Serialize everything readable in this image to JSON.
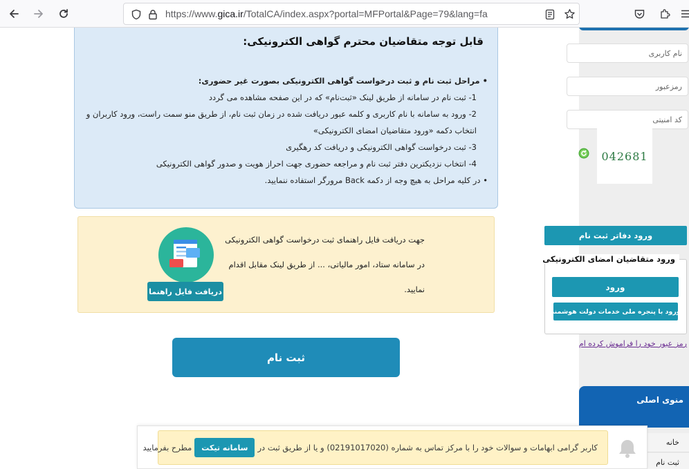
{
  "browser": {
    "url_prefix": "https://www.",
    "url_host": "gica.ir",
    "url_path": "/TotalCA/index.aspx?portal=MFPortal&Page=79&lang=fa"
  },
  "notice": {
    "title": "قابل توجه متقاضیان محترم گواهی الکترونیکی:",
    "steps_heading": "مراحل ثبت نام و ثبت درخواست گواهی الکترونیکی بصورت غیر حضوری:",
    "step1": "1- ثبت نام در سامانه از طریق لینک «ثبت‌نام» که در این صفحه مشاهده می گردد",
    "step2a": "2- ورود به سامانه با نام کاربری و کلمه عبور دریافت شده در زمان ثبت نام، از طریق منو سمت راست، ورود کاربران و",
    "step2b": "انتخاب دکمه «ورود متقاضیان امضای الکترونیکی»",
    "step3": "3- ثبت درخواست گواهی الکترونیکی و دریافت کد رهگیری",
    "step4": "4- انتخاب نزدیکترین دفتر ثبت نام و مراجعه حضوری جهت احراز هویت و صدور گواهی الکترونیکی",
    "back_note": "در کلیه مراحل به هیچ وجه از دکمه Back مرورگر استفاده ننمایید."
  },
  "guide": {
    "line1": "جهت دریافت فایل راهنمای ثبت درخواست گواهی الکترونیکی",
    "line2": "در سامانه ستاد، امور مالیاتی، ... از طریق لینک مقابل اقدام",
    "line3": "نمایید.",
    "download_label": "دریافت فایل راهنما"
  },
  "register_label": "ثبت نام",
  "sidebar": {
    "username_placeholder": "نام کاربری",
    "password_placeholder": "رمزعبور",
    "captcha_placeholder": "کد امنیتی",
    "captcha_code": "042681",
    "offices_login_label": "ورود دفاتر ثبت نام",
    "applicants_legend": "ورود متقاضیان امضای الکترونیکی",
    "login_label": "ورود",
    "gov_login_label": "ورود با پنجره ملی خدمات دولت هوشمند",
    "forgot_password": "رمز عبور خود را فراموش کرده ام",
    "main_menu_title": "منوی اصلی",
    "menu_items": [
      "خانه",
      "ثبت نام"
    ]
  },
  "footer": {
    "text_before": "کاربر گرامی ابهامات و سوالات خود را با مرکز تماس به شماره (02191017020) و یا از طریق ثبت در",
    "ticket_label": "سامانه تیکت",
    "text_after": "مطرح بفرمایید"
  },
  "colors": {
    "accent_teal": "#1c97b2",
    "notice_bg": "#dceaf7",
    "guide_bg": "#fdf1cf",
    "register_blue": "#1f8cb8"
  }
}
